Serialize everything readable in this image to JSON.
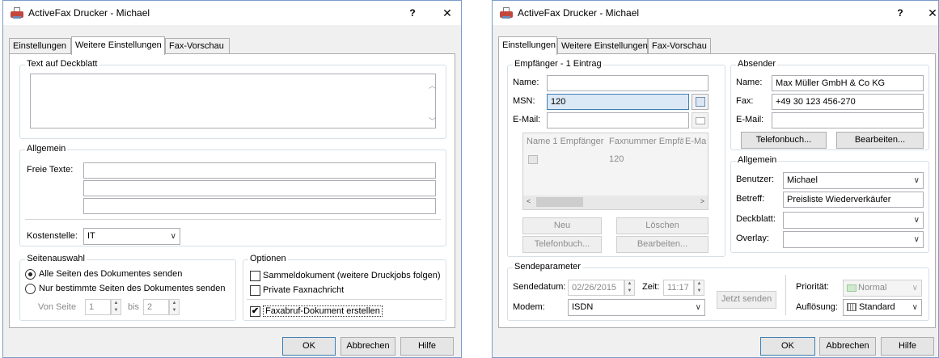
{
  "left": {
    "title": "ActiveFax Drucker - Michael",
    "tabs": [
      "Einstellungen",
      "Weitere Einstellungen",
      "Fax-Vorschau"
    ],
    "active_tab": 1,
    "cover_group": {
      "title": "Text auf Deckblatt",
      "value": ""
    },
    "general": {
      "title": "Allgemein",
      "free_texts_label": "Freie Texte:",
      "free_texts": [
        "",
        "",
        ""
      ],
      "cost_center_label": "Kostenstelle:",
      "cost_center_value": "IT"
    },
    "pages": {
      "title": "Seitenauswahl",
      "option_all": "Alle Seiten des Dokumentes senden",
      "option_some": "Nur bestimmte Seiten des Dokumentes senden",
      "from_label": "Von Seite",
      "from_value": "1",
      "to_label": "bis",
      "to_value": "2"
    },
    "options": {
      "title": "Optionen",
      "items": [
        {
          "label": "Sammeldokument (weitere Druckjobs folgen)",
          "checked": false
        },
        {
          "label": "Private Faxnachricht",
          "checked": false
        },
        {
          "label": "Faxabruf-Dokument erstellen",
          "checked": true
        }
      ]
    },
    "buttons": {
      "ok": "OK",
      "cancel": "Abbrechen",
      "help": "Hilfe"
    }
  },
  "right": {
    "title": "ActiveFax Drucker - Michael",
    "tabs": [
      "Einstellungen",
      "Weitere Einstellungen",
      "Fax-Vorschau"
    ],
    "active_tab": 0,
    "recipient": {
      "title": "Empfänger - 1 Eintrag",
      "name_label": "Name:",
      "name_value": "",
      "msn_label": "MSN:",
      "msn_value": "120",
      "email_label": "E-Mail:",
      "email_value": "",
      "list_columns": [
        "Name 1 Empfänger",
        "Faxnummer Empfäng",
        "E-Ma"
      ],
      "list_rows": [
        {
          "name": "",
          "fax": "120"
        }
      ],
      "new_button": "Neu",
      "delete_button": "Löschen",
      "phonebook_button": "Telefonbuch...",
      "edit_button": "Bearbeiten..."
    },
    "sender": {
      "title": "Absender",
      "name_label": "Name:",
      "name_value": "Max Müller GmbH & Co KG",
      "fax_label": "Fax:",
      "fax_value": "+49 30 123 456-270",
      "email_label": "E-Mail:",
      "email_value": "",
      "phonebook_button": "Telefonbuch...",
      "edit_button": "Bearbeiten..."
    },
    "general": {
      "title": "Allgemein",
      "user_label": "Benutzer:",
      "user_value": "Michael",
      "subject_label": "Betreff:",
      "subject_value": "Preisliste Wiederverkäufer",
      "cover_label": "Deckblatt:",
      "cover_value": "",
      "overlay_label": "Overlay:",
      "overlay_value": ""
    },
    "send": {
      "title": "Sendeparameter",
      "date_label": "Sendedatum:",
      "date_value": "02/26/2015",
      "time_label": "Zeit:",
      "time_value": "11:17",
      "modem_label": "Modem:",
      "modem_value": "ISDN",
      "send_now_button": "Jetzt senden",
      "priority_label": "Priorität:",
      "priority_value": "Normal",
      "resolution_label": "Auflösung:",
      "resolution_value": "Standard"
    },
    "buttons": {
      "ok": "OK",
      "cancel": "Abbrechen",
      "help": "Hilfe"
    }
  },
  "window_controls": {
    "help_glyph": "?",
    "close_glyph": "✕"
  },
  "colors": {
    "title_border": "#7a9ccc",
    "focus_border": "#3c7fb1",
    "dialog_bg": "#f0f0f0"
  }
}
